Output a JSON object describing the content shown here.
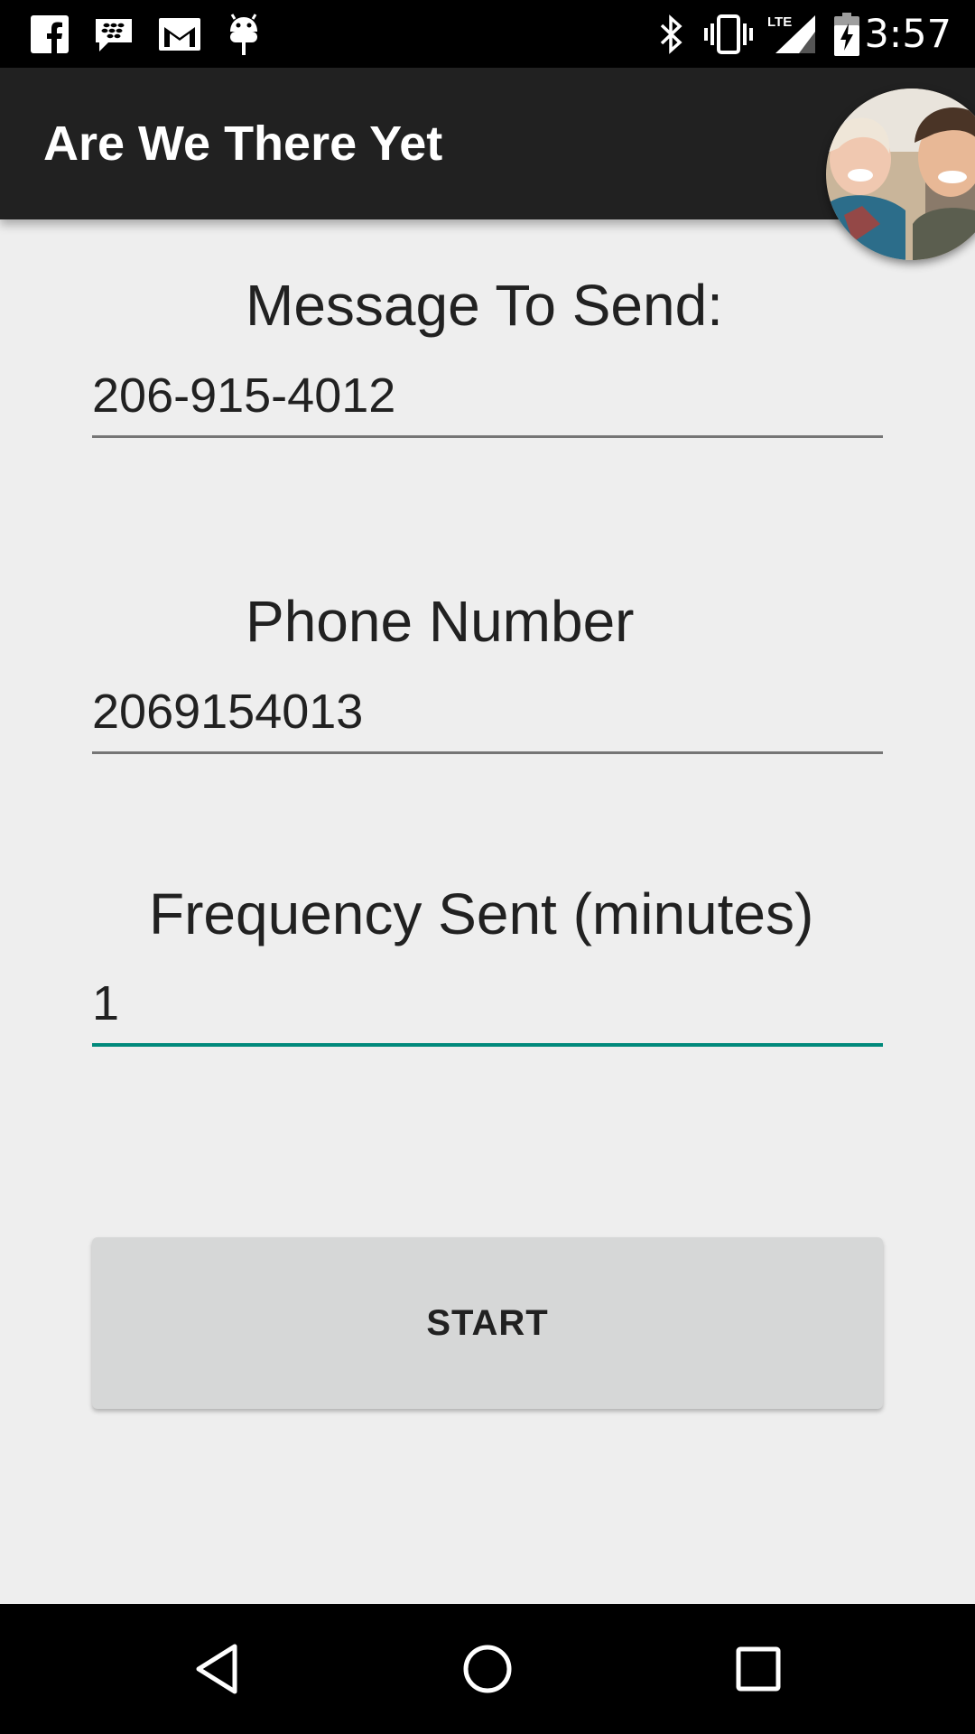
{
  "status_bar": {
    "time": "3:57",
    "notification_icons": [
      "facebook-icon",
      "blackberry-messenger-icon",
      "gmail-icon",
      "android-debug-icon"
    ],
    "system_icons": [
      "bluetooth-icon",
      "vibrate-icon",
      "lte-signal-icon",
      "battery-charging-icon"
    ],
    "lte_label": "LTE"
  },
  "app_bar": {
    "title": "Are We There Yet",
    "background_color": "#212121"
  },
  "avatar": {
    "icon": "chat-head-photo"
  },
  "form": {
    "message_label": "Message To Send:",
    "message_value": "206-915-4012",
    "phone_label": "Phone Number",
    "phone_value": "2069154013",
    "frequency_label": "Frequency Sent (minutes)",
    "frequency_value": "1",
    "start_label": "START",
    "accent_color": "#00897b"
  },
  "nav_bar": {
    "icons": [
      "back-icon",
      "home-icon",
      "recents-icon"
    ]
  }
}
